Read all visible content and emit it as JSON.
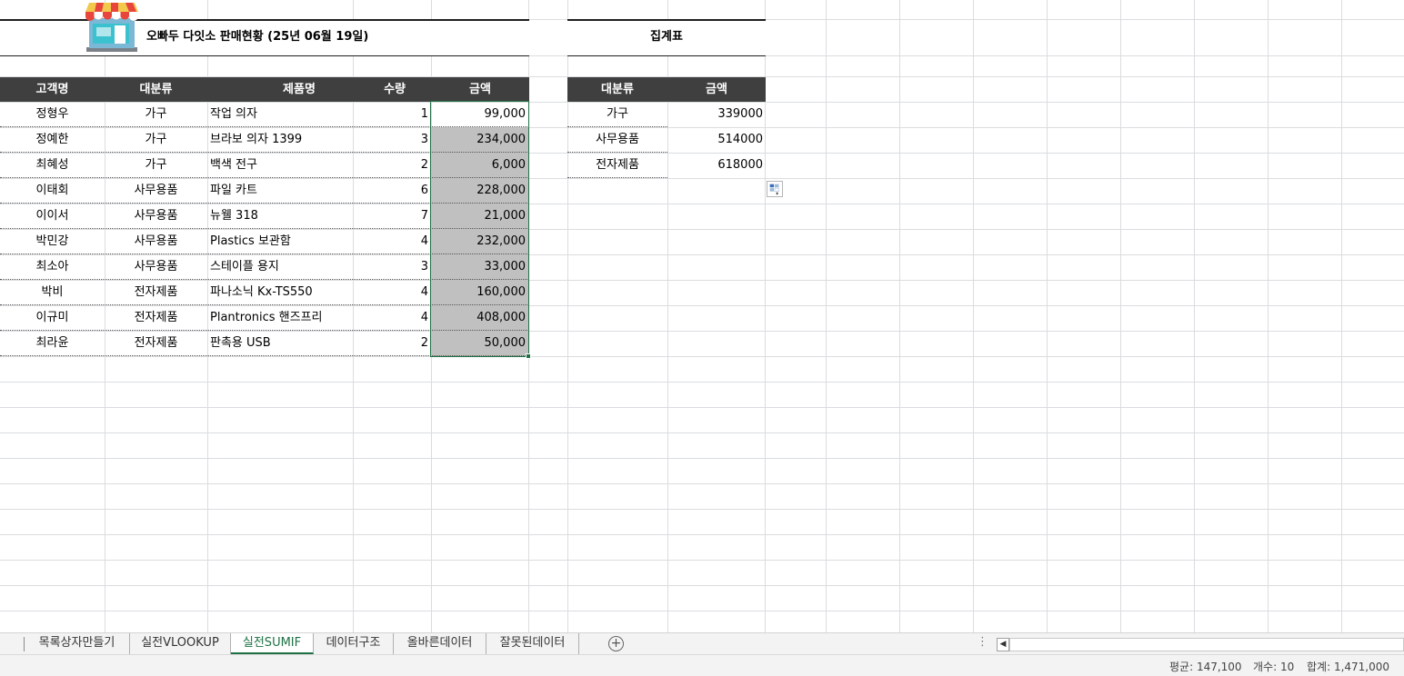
{
  "sheet": {
    "title": "오빠두 다잇소 판매현황 (25년 06월 19일)",
    "summary_title": "집계표",
    "table": {
      "headers": [
        "고객명",
        "대분류",
        "제품명",
        "수량",
        "금액"
      ],
      "rows": [
        {
          "name": "정형우",
          "category": "가구",
          "product": "작업 의자",
          "qty": "1",
          "amount": "99,000"
        },
        {
          "name": "정예한",
          "category": "가구",
          "product": "브라보 의자 1399",
          "qty": "3",
          "amount": "234,000"
        },
        {
          "name": "최혜성",
          "category": "가구",
          "product": "백색 전구",
          "qty": "2",
          "amount": "6,000"
        },
        {
          "name": "이태회",
          "category": "사무용품",
          "product": "파일 카트",
          "qty": "6",
          "amount": "228,000"
        },
        {
          "name": "이이서",
          "category": "사무용품",
          "product": "뉴웰 318",
          "qty": "7",
          "amount": "21,000"
        },
        {
          "name": "박민강",
          "category": "사무용품",
          "product": "Plastics 보관함",
          "qty": "4",
          "amount": "232,000"
        },
        {
          "name": "최소아",
          "category": "사무용품",
          "product": "스테이플 용지",
          "qty": "3",
          "amount": "33,000"
        },
        {
          "name": "박비",
          "category": "전자제품",
          "product": "파나소닉 Kx-TS550",
          "qty": "4",
          "amount": "160,000"
        },
        {
          "name": "이규미",
          "category": "전자제품",
          "product": "Plantronics 핸즈프리",
          "qty": "4",
          "amount": "408,000"
        },
        {
          "name": "최라윤",
          "category": "전자제품",
          "product": "판촉용 USB",
          "qty": "2",
          "amount": "50,000"
        }
      ]
    },
    "summary": {
      "headers": [
        "대분류",
        "금액"
      ],
      "rows": [
        {
          "category": "가구",
          "amount": "339000"
        },
        {
          "category": "사무용품",
          "amount": "514000"
        },
        {
          "category": "전자제품",
          "amount": "618000"
        }
      ]
    }
  },
  "tabs": [
    {
      "label": "목록상자만들기",
      "active": false
    },
    {
      "label": "실전VLOOKUP",
      "active": false
    },
    {
      "label": "실전SUMIF",
      "active": true
    },
    {
      "label": "데이터구조",
      "active": false
    },
    {
      "label": "올바른데이터",
      "active": false
    },
    {
      "label": "잘못된데이터",
      "active": false
    }
  ],
  "add_tab_symbol": "+",
  "more_symbol": "⋮",
  "scroll_left_symbol": "◀",
  "status": {
    "average": "평균: 147,100",
    "count": "개수: 10",
    "sum": "합계: 1,471,000"
  },
  "colors": {
    "header_bg": "#3f3f3f",
    "selection_fill": "#c0c0c0",
    "accent_green": "#1e7145"
  },
  "icons": {
    "store": "store-icon",
    "paste_options": "paste-options-icon",
    "add_sheet": "plus-circle-icon"
  }
}
